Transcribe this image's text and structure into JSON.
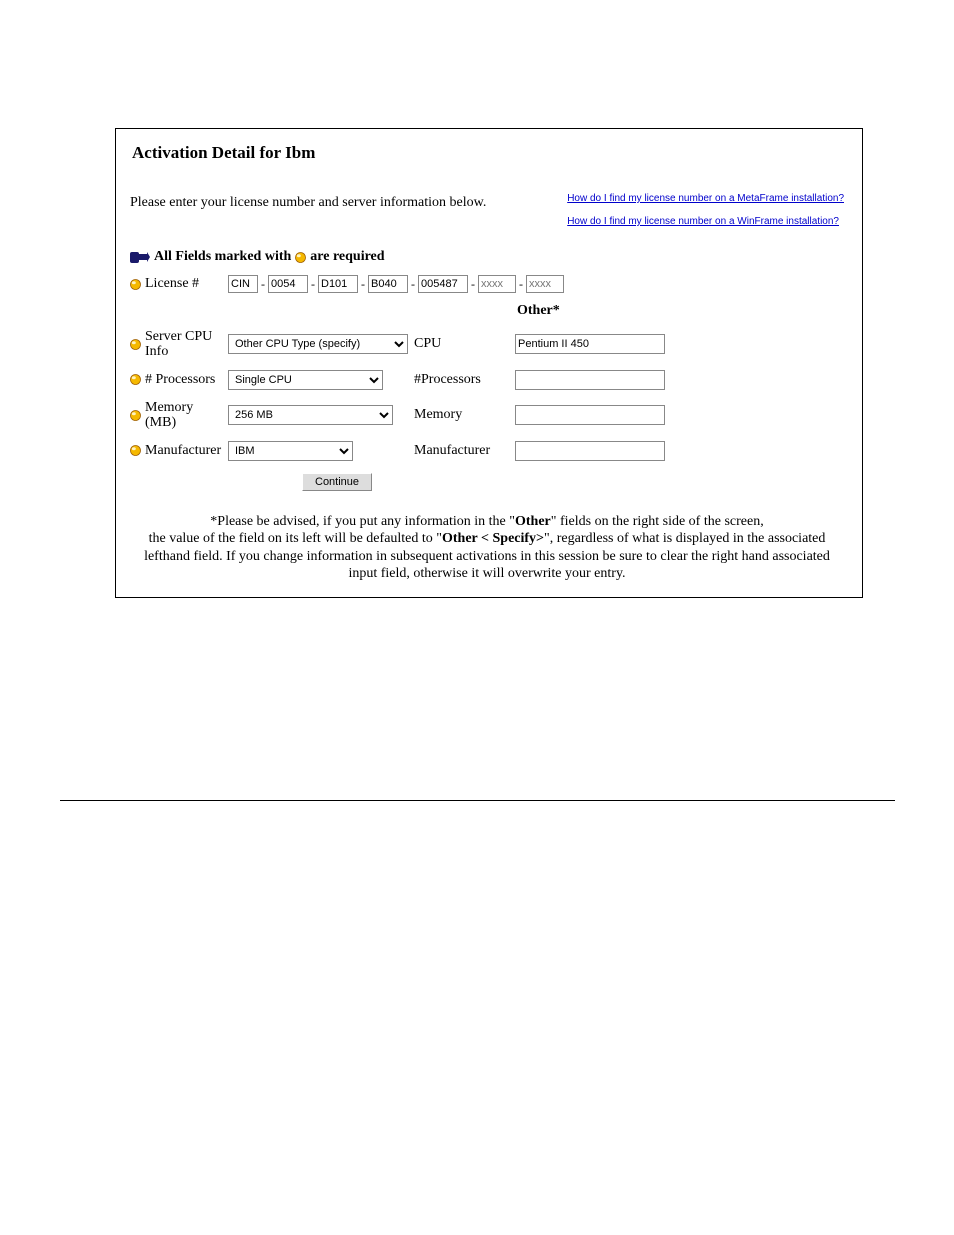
{
  "title": "Activation Detail for Ibm",
  "instruction": "Please enter your license number and server information below.",
  "links": {
    "metaframe": "How do I find my license number on a MetaFrame installation?",
    "winframe": "How do I find my license number on  a WinFrame installation?"
  },
  "required_text_prefix": "All Fields marked with",
  "required_text_suffix": "are required",
  "labels": {
    "license": "License #",
    "cpu": "Server CPU Info",
    "processors": "# Processors",
    "memory": "Memory (MB)",
    "manufacturer": "Manufacturer"
  },
  "other_header": "Other*",
  "mid_labels": {
    "cpu": "CPU",
    "processors": "#Processors",
    "memory": "Memory",
    "manufacturer": "Manufacturer"
  },
  "license": {
    "seg1": "CIN",
    "seg2": "0054",
    "seg3": "D101",
    "seg4": "B040",
    "seg5": "005487",
    "seg6_placeholder": "xxxx",
    "seg7_placeholder": "xxxx"
  },
  "selects": {
    "cpu": "Other CPU Type (specify)",
    "processors": "Single CPU",
    "memory": "256 MB",
    "manufacturer": "IBM"
  },
  "other_inputs": {
    "cpu": "Pentium II 450",
    "processors": "",
    "memory": "",
    "manufacturer": ""
  },
  "continue_label": "Continue",
  "note": {
    "line1": "*Please be advised, if you put any information in the \"",
    "bold1": "Other",
    "line1b": "\" fields on the right side of the screen,",
    "line2a": "the value of the field on its left will be defaulted to \"",
    "bold2": "Other < Specify>",
    "line2b": "\", regardless of what is displayed in the associated lefthand field.  If you change information in subsequent activations in this session be sure to clear the right hand associated input field, otherwise it will overwrite your entry."
  }
}
